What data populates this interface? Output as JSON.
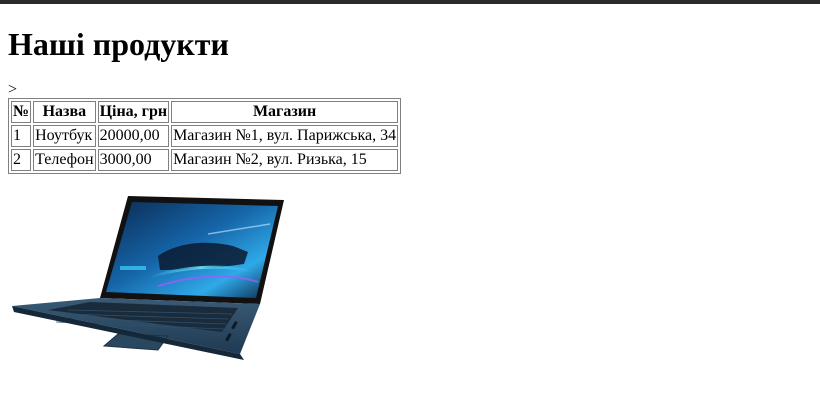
{
  "page": {
    "title": "Наші продукти",
    "stray_text": ">"
  },
  "table": {
    "headers": [
      "№",
      "Назва",
      "Ціна, грн",
      "Магазин"
    ],
    "rows": [
      [
        "1",
        "Ноутбук",
        "20000,00",
        "Магазин №1, вул. Парижська, 34"
      ],
      [
        "2",
        "Телефон",
        "3000,00",
        "Магазин №2, вул. Ризька, 15"
      ]
    ]
  },
  "image": {
    "icon": "laptop-image",
    "colors": {
      "body": "#2d4a63",
      "screen_glow": "#2fa9e8",
      "bezel": "#111111"
    }
  }
}
